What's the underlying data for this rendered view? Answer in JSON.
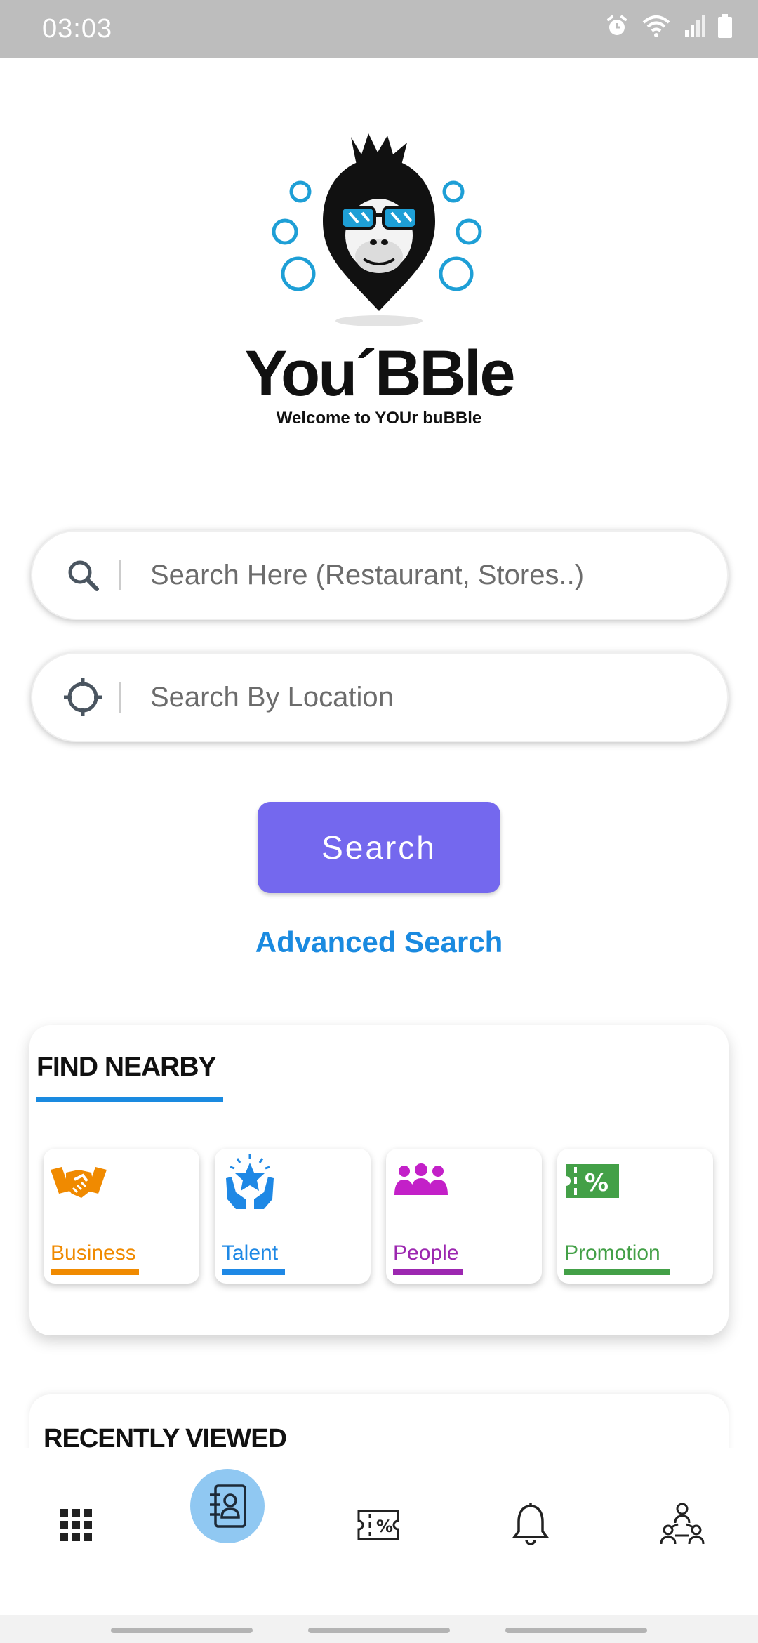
{
  "status_bar": {
    "time": "03:03",
    "icons": [
      "alarm-icon",
      "wifi-icon",
      "signal-icon",
      "battery-icon"
    ]
  },
  "brand": {
    "name": "You´BBle",
    "tagline": "Welcome to YOUr buBBle",
    "colors": {
      "bubble": "#1e9fd6",
      "mascot": "#111111"
    }
  },
  "search": {
    "query_placeholder": "Search Here (Restaurant, Stores..)",
    "query_value": "",
    "location_placeholder": "Search By Location",
    "location_value": "",
    "button_label": "Search",
    "advanced_label": "Advanced Search",
    "colors": {
      "button": "#7468ee",
      "link": "#1a8ae0"
    }
  },
  "find_nearby": {
    "title": "FIND NEARBY",
    "underline_color": "#1a8ae0",
    "items": [
      {
        "label": "Business",
        "icon": "handshake-icon",
        "color": "#f08a00"
      },
      {
        "label": "Talent",
        "icon": "talent-star-hands-icon",
        "color": "#1e88e5"
      },
      {
        "label": "People",
        "icon": "people-group-icon",
        "color": "#9c27b0"
      },
      {
        "label": "Promotion",
        "icon": "promotion-coupon-icon",
        "color": "#43a047"
      }
    ]
  },
  "recently_viewed": {
    "title": "RECENTLY VIEWED"
  },
  "bottom_nav": {
    "items": [
      {
        "icon": "grid-menu-icon",
        "active": false
      },
      {
        "icon": "contact-directory-icon",
        "active": true
      },
      {
        "icon": "coupon-percent-icon",
        "active": false
      },
      {
        "icon": "bell-icon",
        "active": false
      },
      {
        "icon": "community-network-icon",
        "active": false
      }
    ],
    "active_color": "#90c8f2"
  }
}
